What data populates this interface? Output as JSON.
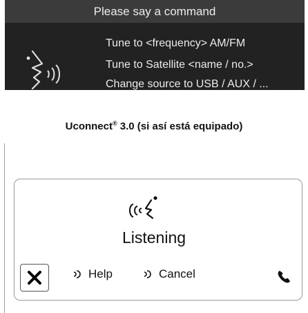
{
  "top_screen": {
    "title": "Please say a command",
    "commands": [
      "Tune to <frequency> AM/FM",
      "Tune to Satellite <name / no.>",
      "Change source to USB / AUX / ..."
    ],
    "icon": "voice-speaker-icon"
  },
  "caption": {
    "text": "Uconnect",
    "superscript": "®",
    "suffix": " 3.0 (si así está equipado)"
  },
  "card": {
    "status": "Listening",
    "status_icon": "listening-face-icon",
    "close_icon": "close-icon",
    "help_label": "Help",
    "cancel_label": "Cancel",
    "phone_icon": "phone-icon"
  }
}
